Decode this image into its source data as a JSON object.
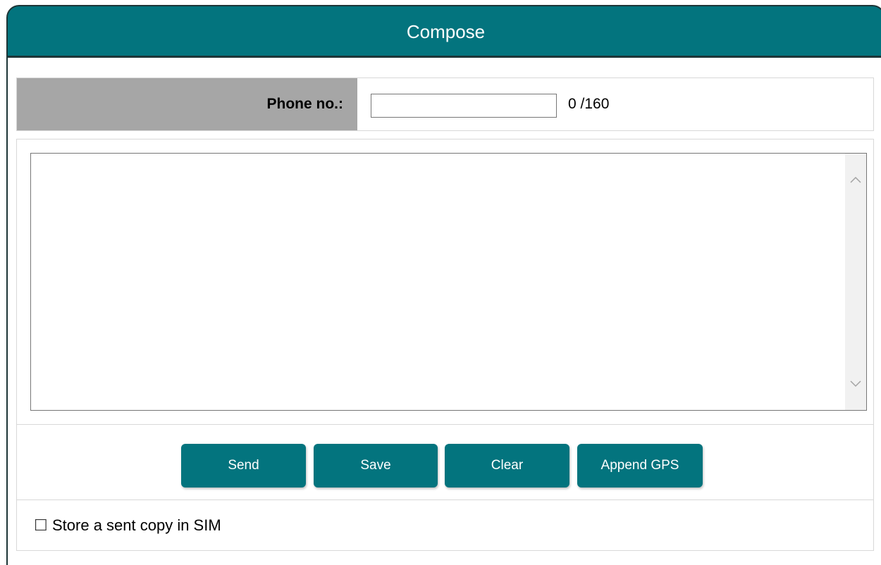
{
  "header": {
    "title": "Compose"
  },
  "phone": {
    "label": "Phone no.:",
    "value": "",
    "counter": "0 /160"
  },
  "message": {
    "value": "",
    "scroll_up_icon": "chevron-up-icon",
    "scroll_down_icon": "chevron-down-icon"
  },
  "buttons": {
    "send": "Send",
    "save": "Save",
    "clear": "Clear",
    "append_gps": "Append GPS"
  },
  "store": {
    "checked": false,
    "label": "Store a sent copy in SIM"
  },
  "colors": {
    "accent": "#03747e",
    "label_bg": "#a6a6a6"
  }
}
